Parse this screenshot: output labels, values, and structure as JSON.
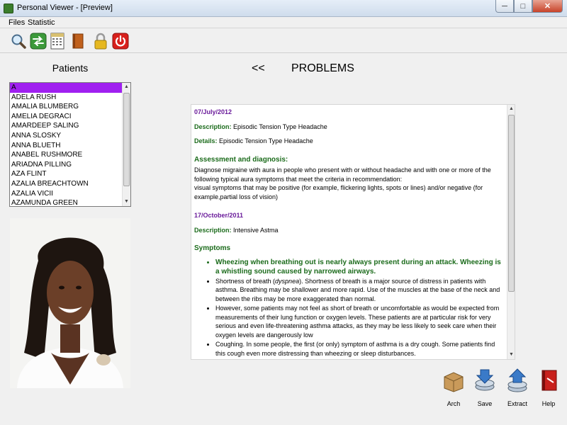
{
  "window": {
    "title": "Personal Viewer - [Preview]",
    "controls": [
      "minimize",
      "maximize",
      "close"
    ]
  },
  "menu": {
    "items": [
      "Files",
      "Statistic"
    ]
  },
  "toolbar": {
    "buttons": [
      {
        "icon": "search-icon"
      },
      {
        "icon": "exchange-icon"
      },
      {
        "icon": "calculator-icon"
      },
      {
        "icon": "book-icon"
      },
      {
        "icon": "lock-icon"
      },
      {
        "icon": "power-icon"
      }
    ]
  },
  "patients": {
    "label": "Patients",
    "items": [
      "A",
      "ADELA RUSH",
      "AMALIA BLUMBERG",
      "AMELIA DEGRACI",
      "AMARDEEP SALING",
      "ANNA SLOSKY",
      "ANNA BLUETH",
      "ANABEL RUSHMORE",
      "ARIADNA PILLING",
      "AZA FLINT",
      "AZALIA BREACHTOWN",
      "AZALIA VICII",
      "AZAMUNDA GREEN"
    ],
    "selected_index": 0
  },
  "section": {
    "nav_prev": "<<",
    "title": "PROBLEMS"
  },
  "records": [
    {
      "date": "07/July/2012",
      "description_label": "Description:",
      "description": "Episodic Tension Type Headache",
      "details_label": "Details:",
      "details": "Episodic Tension Type Headache",
      "assessment_label": "Assessment and diagnosis:",
      "assessment_text": "Diagnose migraine with aura in people who present with or without headache and with one or more of the following typical aura symptoms that meet the criteria in recommendation:",
      "assessment_text2": "visual symptoms that may be positive (for example, flickering lights, spots or lines) and/or negative (for example,partial loss of vision)"
    },
    {
      "date": "17/October/2011",
      "description_label": "Description:",
      "description": "Intensive Astma",
      "symptoms_label": "Symptoms",
      "symptoms": [
        {
          "text": "Wheezing when breathing out is nearly always present during an attack. Wheezing is a whistling sound caused by narrowed airways."
        },
        {
          "pre": "Shortness of breath (",
          "em": "dyspnea",
          "post": "). Shortness of breath is a major source of distress in patients with asthma. Breathing may be shallower and more rapid. Use of the muscles at the base of the neck and between the ribs may be more exaggerated than normal."
        },
        {
          "text": "However, some patients may not feel as short of breath or uncomfortable as would be expected from measurements of their lung function or oxygen levels. These patients are at particular risk for very serious and even life-threatening asthma attacks, as they may be less likely to seek care when their oxygen levels are dangerously low"
        },
        {
          "text": "Coughing. In some people, the first (or only) symptom of asthma is a dry cough. Some patients find this cough even more distressing than wheezing or sleep disturbances."
        }
      ]
    }
  ],
  "actions": [
    {
      "label": "Arch",
      "icon": "archive-box-icon"
    },
    {
      "label": "Save",
      "icon": "save-icon"
    },
    {
      "label": "Extract",
      "icon": "extract-icon"
    },
    {
      "label": "Help",
      "icon": "help-book-icon"
    }
  ]
}
